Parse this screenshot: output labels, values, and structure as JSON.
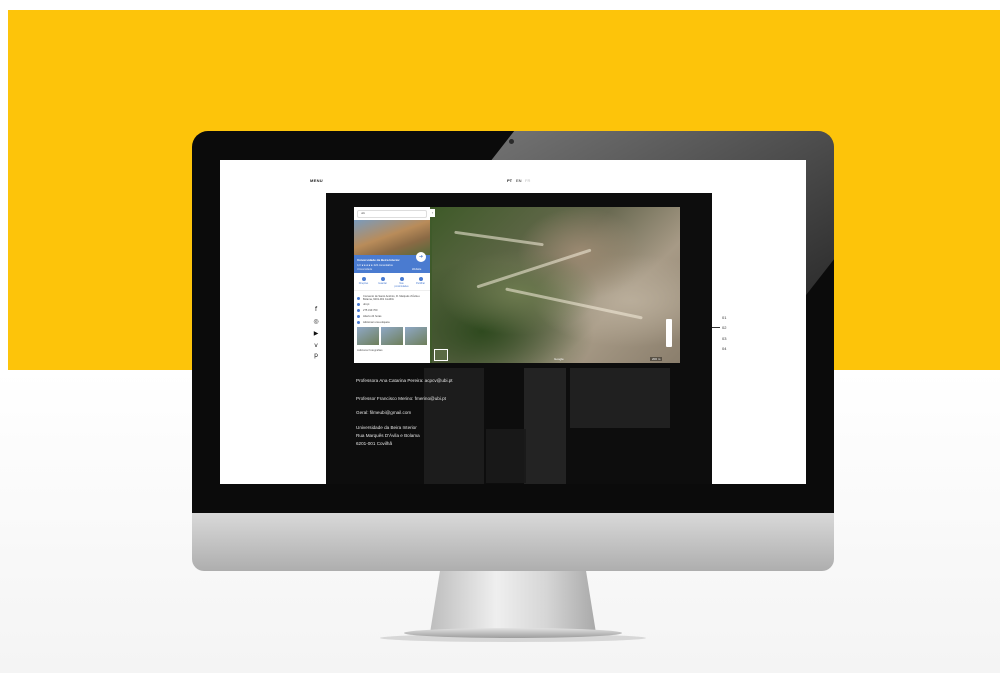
{
  "site": {
    "menu_label": "MENU",
    "languages": [
      {
        "code": "PT"
      },
      {
        "code": "EN"
      },
      {
        "code": "FR"
      }
    ],
    "social_icons": [
      "facebook-icon",
      "instagram-icon",
      "youtube-icon",
      "vimeo-icon",
      "pinterest-icon"
    ],
    "pager": [
      "01",
      "02",
      "03",
      "04"
    ],
    "active_page": "02"
  },
  "map": {
    "search_text": "ubi",
    "place_title": "Universidade da Beira Interior",
    "rating_text": "4,3 ★★★★★  224 comentários",
    "place_type": "Universidade",
    "website_label": "Website",
    "actions": [
      "Direções",
      "Guardar",
      "Nas proximidades",
      "Partilhar"
    ],
    "details": [
      "Convento de Santo António, R. Marquês d'Ávila e Bolama, 6201-001 Covilhã",
      "ubi.pt",
      "275 319 700",
      "Aberto 24 horas",
      "Adicionar uma etiqueta"
    ],
    "footer_label": "Adicionar fotografias",
    "brand_label": "Google",
    "scale_label": "200 m"
  },
  "contact": {
    "lines": [
      "Professora Ana Catarina Pereira: acpcv@ubi.pt",
      "Professor Francisco Merino: fmerino@ubi.pt",
      "Geral: filmeubi@gmail.com",
      "Universidade da Beira Interior",
      "Rua Marquês D'Ávila e Bolama",
      "6201-001 Covilhã"
    ]
  },
  "colors": {
    "background_band": "#fdc40a",
    "panel": "#0d0d0d",
    "map_header": "#4a7bd0"
  }
}
